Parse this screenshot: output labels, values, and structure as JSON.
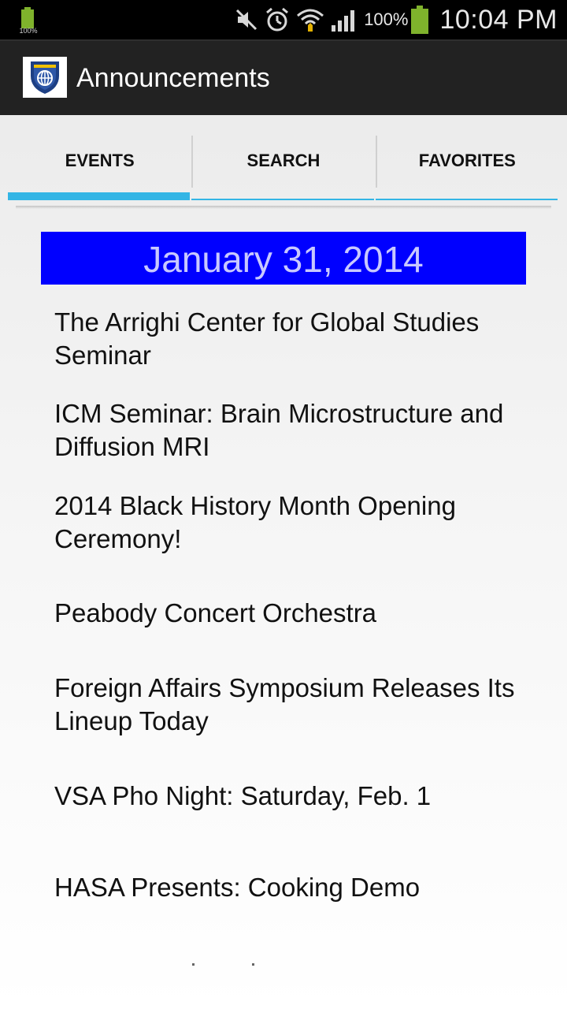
{
  "status_bar": {
    "small_battery_pct": "100%",
    "battery_pct": "100%",
    "time": "10:04 PM",
    "icons": [
      "battery-icon",
      "mute-icon",
      "alarm-icon",
      "wifi-icon",
      "signal-icon",
      "battery-icon"
    ],
    "accent_color": "#7fb22c"
  },
  "action_bar": {
    "title": "Announcements",
    "logo_icon": "university-shield-logo"
  },
  "tabs": [
    {
      "label": "EVENTS",
      "selected": true
    },
    {
      "label": "SEARCH",
      "selected": false
    },
    {
      "label": "FAVORITES",
      "selected": false
    }
  ],
  "tab_indicator_color": "#33b5e5",
  "date_header": {
    "text": "January 31, 2014",
    "background": "#0000ff"
  },
  "events": [
    {
      "title": "The Arrighi Center for Global Studies Seminar"
    },
    {
      "title": "ICM Seminar: Brain Microstructure and Diffusion MRI"
    },
    {
      "title": "2014 Black History Month Opening Ceremony!"
    },
    {
      "title": "Peabody Concert Orchestra"
    },
    {
      "title": "Foreign Affairs Symposium Releases Its Lineup Today"
    },
    {
      "title": "VSA Pho Night: Saturday, Feb. 1"
    },
    {
      "title": "HASA Presents: Cooking Demo"
    }
  ]
}
